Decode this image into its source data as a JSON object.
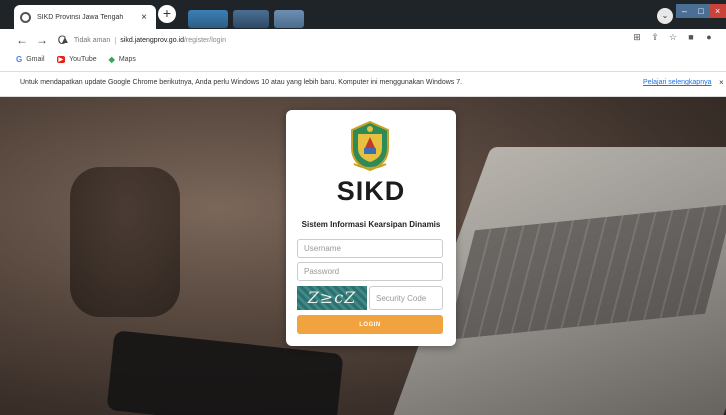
{
  "browser": {
    "tab_title": "SIKD Provinsi Jawa Tengah",
    "tab_close": "×",
    "new_tab": "+",
    "not_secure": "Tidak aman",
    "url_host": "sikd.jatengprov.go.id",
    "url_path": "/register/login",
    "nav": {
      "back": "←",
      "forward": "→",
      "reload": "C"
    }
  },
  "bookmarks": [
    {
      "label": "Gmail",
      "icon": "G"
    },
    {
      "label": "YouTube",
      "icon": "▶"
    },
    {
      "label": "Maps",
      "icon": "◆"
    }
  ],
  "infobar": {
    "message": "Untuk mendapatkan update Google Chrome berikutnya, Anda perlu Windows 10 atau yang lebih baru. Komputer ini menggunakan Windows 7.",
    "link": "Pelajari selengkapnya",
    "close": "×"
  },
  "login": {
    "brand": "SIKD",
    "subtitle": "Sistem Informasi Kearsipan Dinamis",
    "username_placeholder": "Username",
    "password_placeholder": "Password",
    "captcha_text": "Z≥cZ",
    "security_placeholder": "Security Code",
    "login_label": "LOGIN"
  },
  "colors": {
    "accent": "#f0a33e",
    "link": "#1a73e8"
  }
}
